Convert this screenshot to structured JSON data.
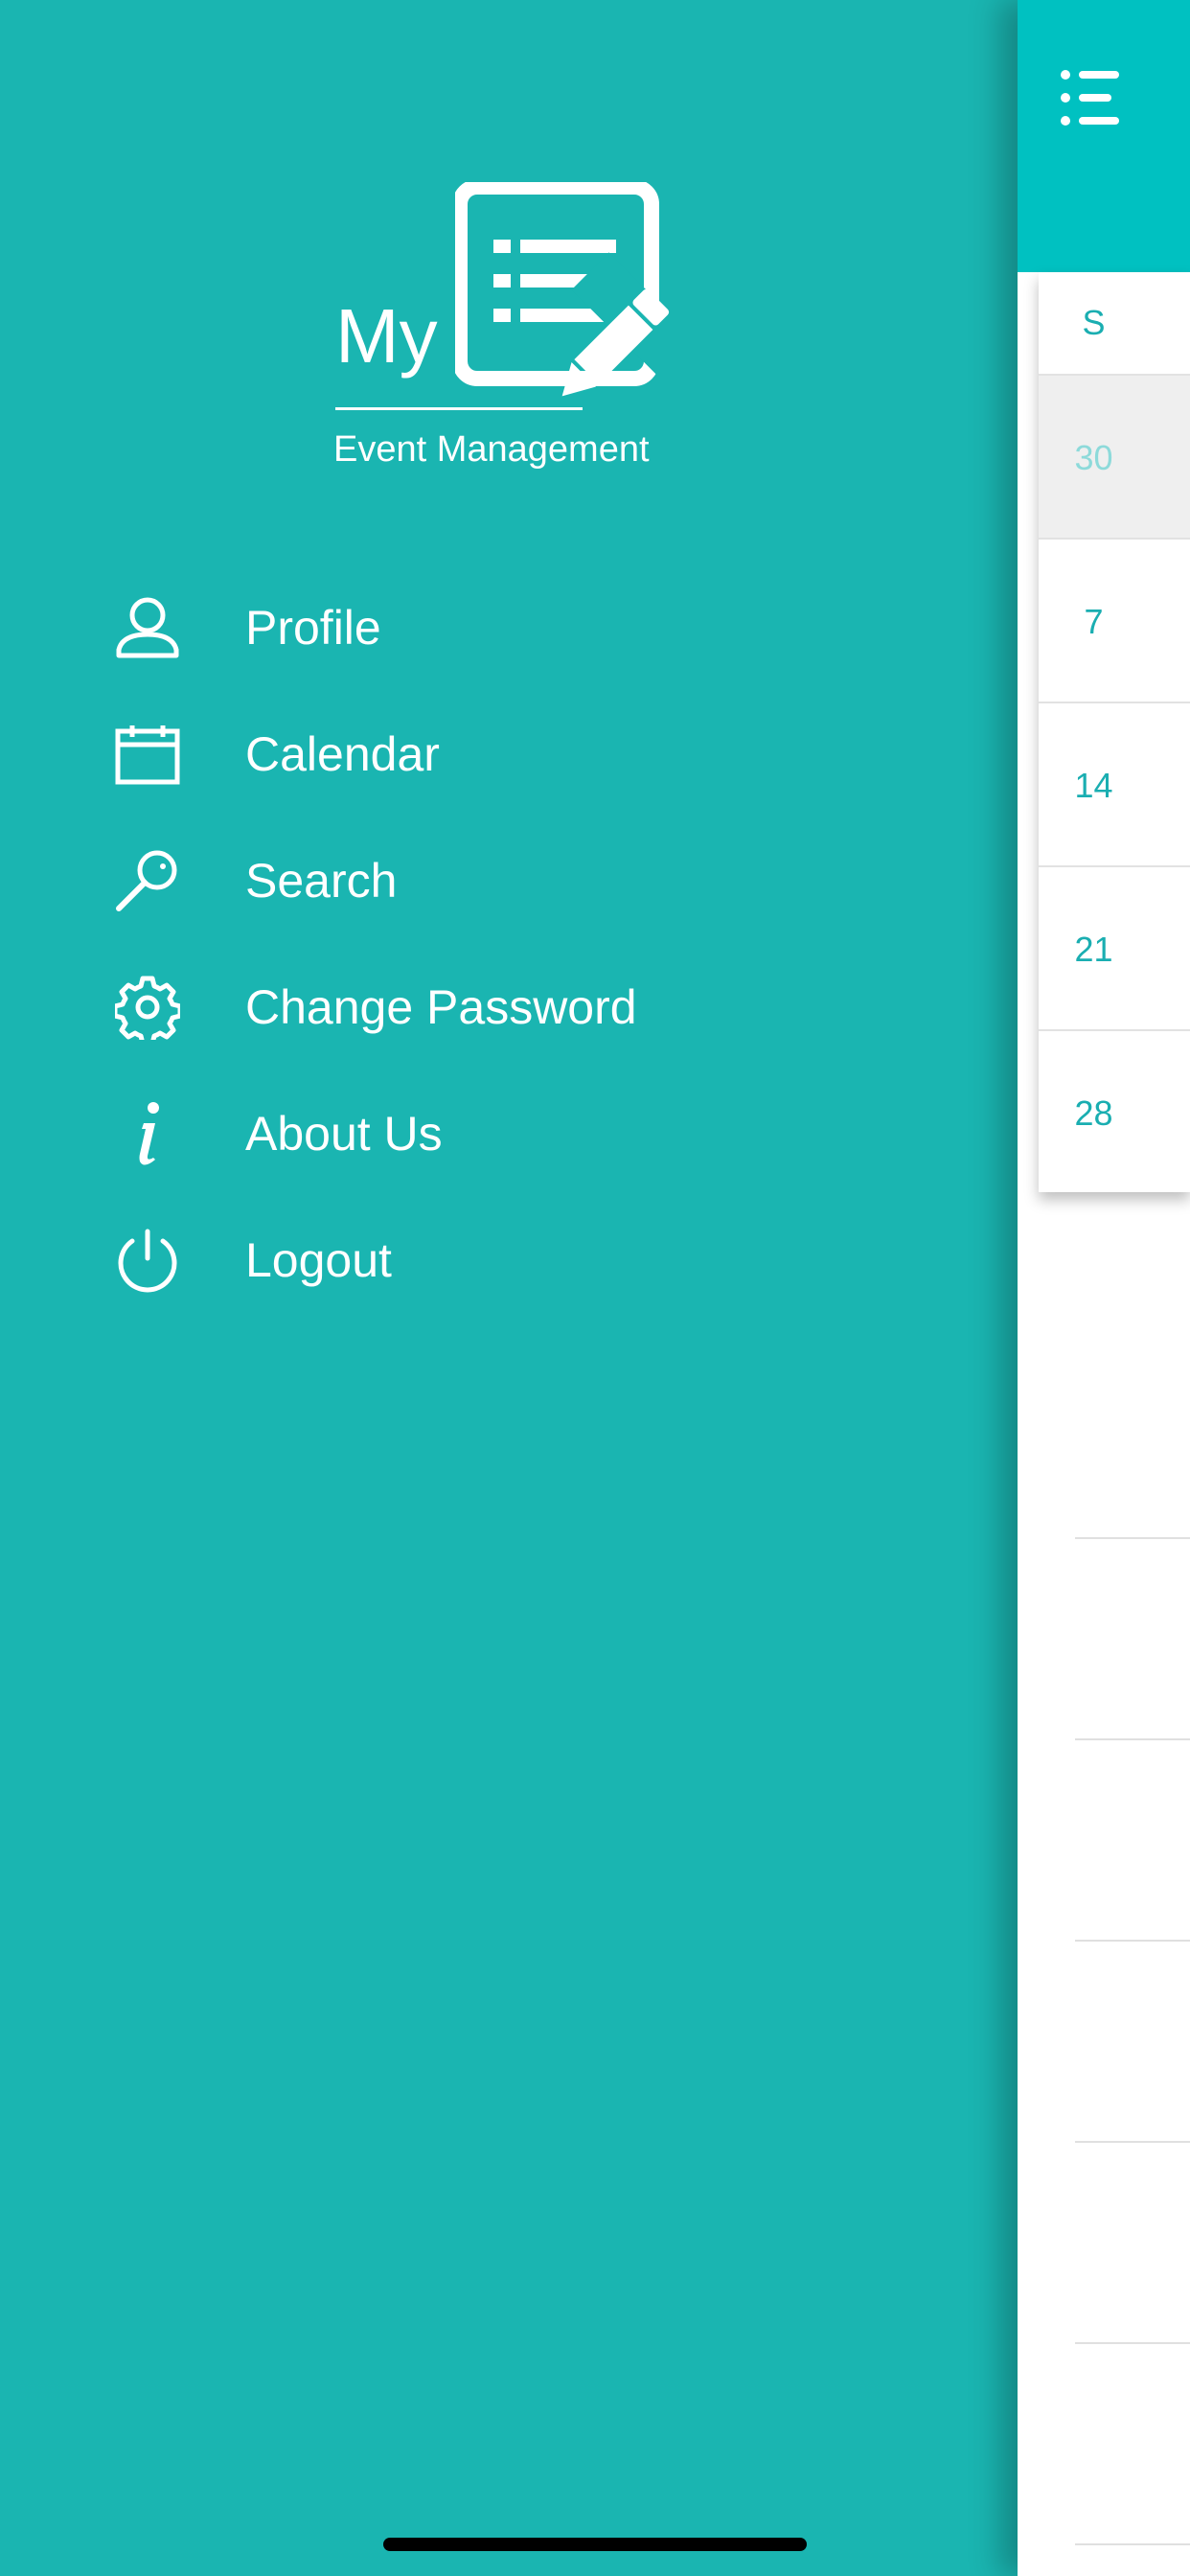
{
  "drawer": {
    "logo_my": "My",
    "logo_subtitle": "Event Management",
    "menu": [
      {
        "label": "Profile",
        "icon": "user-icon"
      },
      {
        "label": "Calendar",
        "icon": "calendar-icon"
      },
      {
        "label": "Search",
        "icon": "search-icon"
      },
      {
        "label": "Change Password",
        "icon": "gear-icon"
      },
      {
        "label": "About Us",
        "icon": "info-icon"
      },
      {
        "label": "Logout",
        "icon": "power-icon"
      }
    ]
  },
  "calendar": {
    "day_of_week": "S",
    "days": [
      "30",
      "7",
      "14",
      "21",
      "28"
    ]
  },
  "colors": {
    "drawer_bg": "#1ab5b1",
    "header_bg": "#00c1c1",
    "accent": "#1aaeb1"
  }
}
